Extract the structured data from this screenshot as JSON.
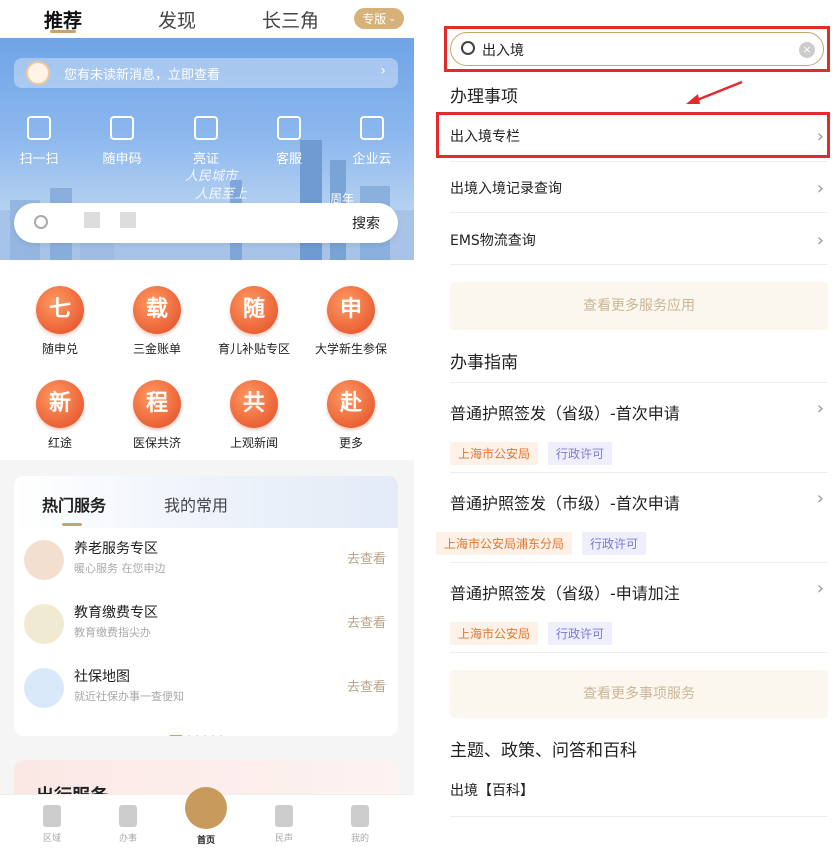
{
  "left": {
    "topnav": {
      "tabs": [
        "推荐",
        "发现",
        "长三角"
      ],
      "active_tab": "推荐",
      "edition_badge": "专版"
    },
    "banner": {
      "message": "您有未读新消息，立即查看",
      "quick_actions": [
        {
          "label": "扫一扫",
          "icon": "scan-icon"
        },
        {
          "label": "随申码",
          "icon": "qrcode-icon"
        },
        {
          "label": "亮证",
          "icon": "id-card-icon"
        },
        {
          "label": "客服",
          "icon": "customer-service-icon"
        },
        {
          "label": "企业云",
          "icon": "enterprise-cloud-icon"
        }
      ],
      "slogan_line1": "人民城市",
      "slogan_line2": "人民至上",
      "anniversary": "周年",
      "search_button": "搜索"
    },
    "services": [
      {
        "glyph": "七",
        "label": "随申兑"
      },
      {
        "glyph": "载",
        "label": "三金账单"
      },
      {
        "glyph": "随",
        "label": "育儿补贴专区"
      },
      {
        "glyph": "申",
        "label": "大学新生参保"
      },
      {
        "glyph": "新",
        "label": "红途"
      },
      {
        "glyph": "程",
        "label": "医保共济"
      },
      {
        "glyph": "共",
        "label": "上观新闻"
      },
      {
        "glyph": "赴",
        "label": "更多"
      }
    ],
    "hot": {
      "tab_hot": "热门服务",
      "tab_mine": "我的常用",
      "rows": [
        {
          "title": "养老服务专区",
          "subtitle": "暖心服务 在您申边",
          "action": "去查看"
        },
        {
          "title": "教育缴费专区",
          "subtitle": "教育缴费指尖办",
          "action": "去查看"
        },
        {
          "title": "社保地图",
          "subtitle": "就近社保办事一查便知",
          "action": "去查看"
        }
      ]
    },
    "travel_title": "出行服务",
    "bottom_nav": [
      "区域",
      "办事",
      "首页",
      "民声",
      "我的"
    ]
  },
  "right": {
    "search": {
      "value": "出入境"
    },
    "section_items_title": "办理事项",
    "items": [
      "出入境专栏",
      "出境入境记录查询",
      "EMS物流查询"
    ],
    "more_services": "查看更多服务应用",
    "section_guide_title": "办事指南",
    "guides": [
      {
        "title": "普通护照签发（省级）-首次申请",
        "org": "上海市公安局",
        "kind": "行政许可"
      },
      {
        "title": "普通护照签发（市级）-首次申请",
        "org": "上海市公安局浦东分局",
        "kind": "行政许可"
      },
      {
        "title": "普通护照签发（省级）-申请加注",
        "org": "上海市公安局",
        "kind": "行政许可"
      }
    ],
    "more_matters": "查看更多事项服务",
    "section_topics_title": "主题、政策、问答和百科",
    "topic_item": "出境【百科】"
  }
}
